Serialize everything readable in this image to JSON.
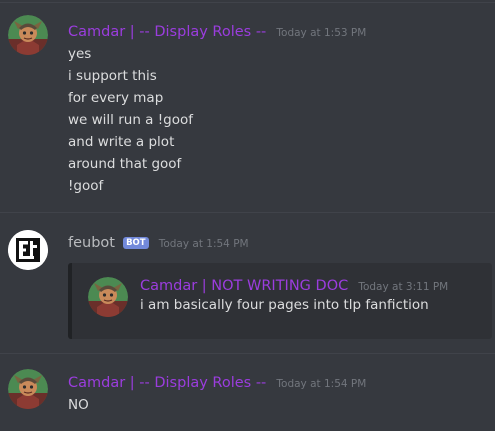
{
  "colors": {
    "background": "#36393f",
    "username": "#9b3dde",
    "bot_username": "#b9bbbe",
    "timestamp": "#72767d",
    "message_text": "#dcddde",
    "bot_tag": "#7289da",
    "embed_background": "#2f3136"
  },
  "messages": [
    {
      "author": "Camdar | -- Display Roles --",
      "timestamp": "Today at 1:53 PM",
      "avatar_icon": "character-avatar-icon",
      "lines": [
        "yes",
        "i support this",
        "for every map",
        "we will run a !goof",
        "and write a plot",
        "around that goof",
        "!goof"
      ]
    },
    {
      "author": "feubot",
      "bot_tag": "BOT",
      "timestamp": "Today at 1:54 PM",
      "avatar_icon": "feubot-logo-icon",
      "embed": {
        "author": "Camdar | NOT WRITING DOC",
        "timestamp": "Today at 3:11 PM",
        "avatar_icon": "character-avatar-icon",
        "text": "i am basically four pages into tlp fanfiction"
      }
    },
    {
      "author": "Camdar | -- Display Roles --",
      "timestamp": "Today at 1:54 PM",
      "avatar_icon": "character-avatar-icon",
      "lines": [
        "NO"
      ]
    }
  ]
}
